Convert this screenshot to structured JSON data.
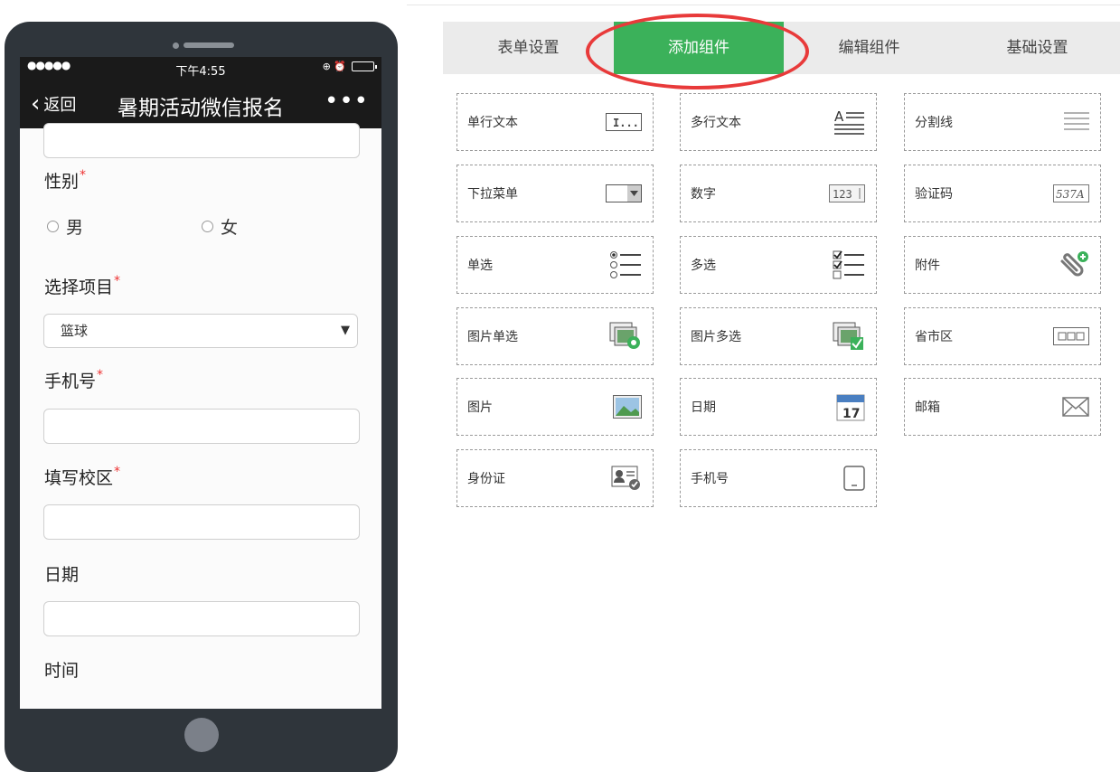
{
  "phone": {
    "status": {
      "signal": "●●●●●",
      "time": "下午4:55",
      "icons": "⊕ ⏰"
    },
    "nav": {
      "back": "返回",
      "title": "暑期活动微信报名",
      "more": "•••"
    },
    "form": {
      "gender_label": "性别",
      "required_mark": "*",
      "gender_options": [
        "男",
        "女"
      ],
      "project_label": "选择项目",
      "project_value": "篮球",
      "phone_label": "手机号",
      "campus_label": "填写校区",
      "date_label": "日期",
      "time_label": "时间"
    }
  },
  "tabs": [
    "表单设置",
    "添加组件",
    "编辑组件",
    "基础设置"
  ],
  "active_tab": "添加组件",
  "components": [
    {
      "label": "单行文本",
      "icon": "single-line-text-icon"
    },
    {
      "label": "多行文本",
      "icon": "multi-line-text-icon"
    },
    {
      "label": "分割线",
      "icon": "divider-icon"
    },
    {
      "label": "下拉菜单",
      "icon": "dropdown-icon"
    },
    {
      "label": "数字",
      "icon": "number-icon"
    },
    {
      "label": "验证码",
      "icon": "captcha-icon"
    },
    {
      "label": "单选",
      "icon": "radio-list-icon"
    },
    {
      "label": "多选",
      "icon": "checkbox-list-icon"
    },
    {
      "label": "附件",
      "icon": "paperclip-icon"
    },
    {
      "label": "图片单选",
      "icon": "image-radio-icon"
    },
    {
      "label": "图片多选",
      "icon": "image-checkbox-icon"
    },
    {
      "label": "省市区",
      "icon": "region-icon"
    },
    {
      "label": "图片",
      "icon": "image-icon"
    },
    {
      "label": "日期",
      "icon": "calendar-icon"
    },
    {
      "label": "邮箱",
      "icon": "envelope-icon"
    },
    {
      "label": "身份证",
      "icon": "id-card-icon"
    },
    {
      "label": "手机号",
      "icon": "mobile-phone-icon"
    }
  ],
  "icon_text": {
    "single_line": "I...",
    "number": "123",
    "captcha": "537A",
    "calendar_day": "17"
  },
  "colors": {
    "active_tab": "#3bb15a",
    "annotation_ellipse": "#e83a3a",
    "required": "#e33333"
  }
}
